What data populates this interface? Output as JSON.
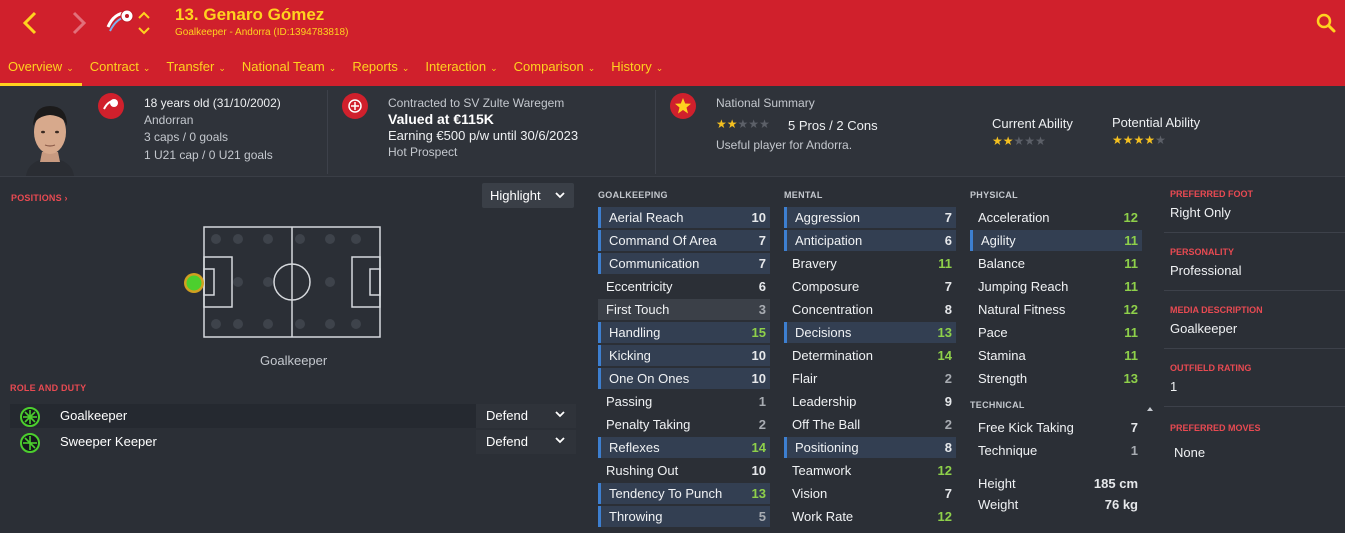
{
  "header": {
    "title": "13. Genaro Gómez",
    "subtitle": "Goalkeeper - Andorra (ID:1394783818)"
  },
  "tabs": [
    {
      "label": "Overview"
    },
    {
      "label": "Contract"
    },
    {
      "label": "Transfer"
    },
    {
      "label": "National Team"
    },
    {
      "label": "Reports"
    },
    {
      "label": "Interaction"
    },
    {
      "label": "Comparison"
    },
    {
      "label": "History"
    }
  ],
  "info": {
    "age": "18 years old (31/10/2002)",
    "nationality": "Andorran",
    "caps": "3 caps / 0 goals",
    "u21caps": "1 U21 cap / 0 U21 goals",
    "contracted": "Contracted to SV Zulte Waregem",
    "valued": "Valued at €115K",
    "earning": "Earning €500 p/w until 30/6/2023",
    "status": "Hot Prospect",
    "national_summary_label": "National Summary",
    "pros_cons": "5 Pros / 2 Cons",
    "national_note": "Useful player for Andorra.",
    "national_stars": 2,
    "current_ability_label": "Current Ability",
    "current_ability_stars": 2,
    "potential_ability_label": "Potential Ability",
    "potential_ability_stars": 4
  },
  "positions": {
    "heading": "POSITIONS",
    "highlight_label": "Highlight",
    "pitch_label": "Goalkeeper"
  },
  "roles": {
    "heading": "ROLE AND DUTY",
    "items": [
      {
        "name": "Goalkeeper",
        "duty": "Defend"
      },
      {
        "name": "Sweeper Keeper",
        "duty": "Defend"
      }
    ]
  },
  "attributes": {
    "goalkeeping": {
      "heading": "GOALKEEPING",
      "items": [
        {
          "name": "Aerial Reach",
          "value": "10"
        },
        {
          "name": "Command Of Area",
          "value": "7"
        },
        {
          "name": "Communication",
          "value": "7"
        },
        {
          "name": "Eccentricity",
          "value": "6"
        },
        {
          "name": "First Touch",
          "value": "3"
        },
        {
          "name": "Handling",
          "value": "15"
        },
        {
          "name": "Kicking",
          "value": "10"
        },
        {
          "name": "One On Ones",
          "value": "10"
        },
        {
          "name": "Passing",
          "value": "1"
        },
        {
          "name": "Penalty Taking",
          "value": "2"
        },
        {
          "name": "Reflexes",
          "value": "14"
        },
        {
          "name": "Rushing Out",
          "value": "10"
        },
        {
          "name": "Tendency To Punch",
          "value": "13"
        },
        {
          "name": "Throwing",
          "value": "5"
        }
      ]
    },
    "mental": {
      "heading": "MENTAL",
      "items": [
        {
          "name": "Aggression",
          "value": "7"
        },
        {
          "name": "Anticipation",
          "value": "6"
        },
        {
          "name": "Bravery",
          "value": "11"
        },
        {
          "name": "Composure",
          "value": "7"
        },
        {
          "name": "Concentration",
          "value": "8"
        },
        {
          "name": "Decisions",
          "value": "13"
        },
        {
          "name": "Determination",
          "value": "14"
        },
        {
          "name": "Flair",
          "value": "2"
        },
        {
          "name": "Leadership",
          "value": "9"
        },
        {
          "name": "Off The Ball",
          "value": "2"
        },
        {
          "name": "Positioning",
          "value": "8"
        },
        {
          "name": "Teamwork",
          "value": "12"
        },
        {
          "name": "Vision",
          "value": "7"
        },
        {
          "name": "Work Rate",
          "value": "12"
        }
      ]
    },
    "physical": {
      "heading": "PHYSICAL",
      "items": [
        {
          "name": "Acceleration",
          "value": "12"
        },
        {
          "name": "Agility",
          "value": "11"
        },
        {
          "name": "Balance",
          "value": "11"
        },
        {
          "name": "Jumping Reach",
          "value": "11"
        },
        {
          "name": "Natural Fitness",
          "value": "12"
        },
        {
          "name": "Pace",
          "value": "11"
        },
        {
          "name": "Stamina",
          "value": "11"
        },
        {
          "name": "Strength",
          "value": "13"
        }
      ]
    },
    "technical": {
      "heading": "TECHNICAL",
      "items": [
        {
          "name": "Free Kick Taking",
          "value": "7"
        },
        {
          "name": "Technique",
          "value": "1"
        }
      ]
    },
    "height_label": "Height",
    "height_value": "185 cm",
    "weight_label": "Weight",
    "weight_value": "76 kg"
  },
  "right_column": {
    "preferred_foot_label": "PREFERRED FOOT",
    "preferred_foot": "Right Only",
    "personality_label": "PERSONALITY",
    "personality": "Professional",
    "media_label": "MEDIA DESCRIPTION",
    "media": "Goalkeeper",
    "outfield_label": "OUTFIELD RATING",
    "outfield": "1",
    "moves_label": "PREFERRED MOVES",
    "moves": "None"
  },
  "colors": {
    "header_red": "#d0202c",
    "accent_yellow": "#ffd21f",
    "value_green": "#8ed04a",
    "highlight_blue": "#3d7fd0"
  }
}
